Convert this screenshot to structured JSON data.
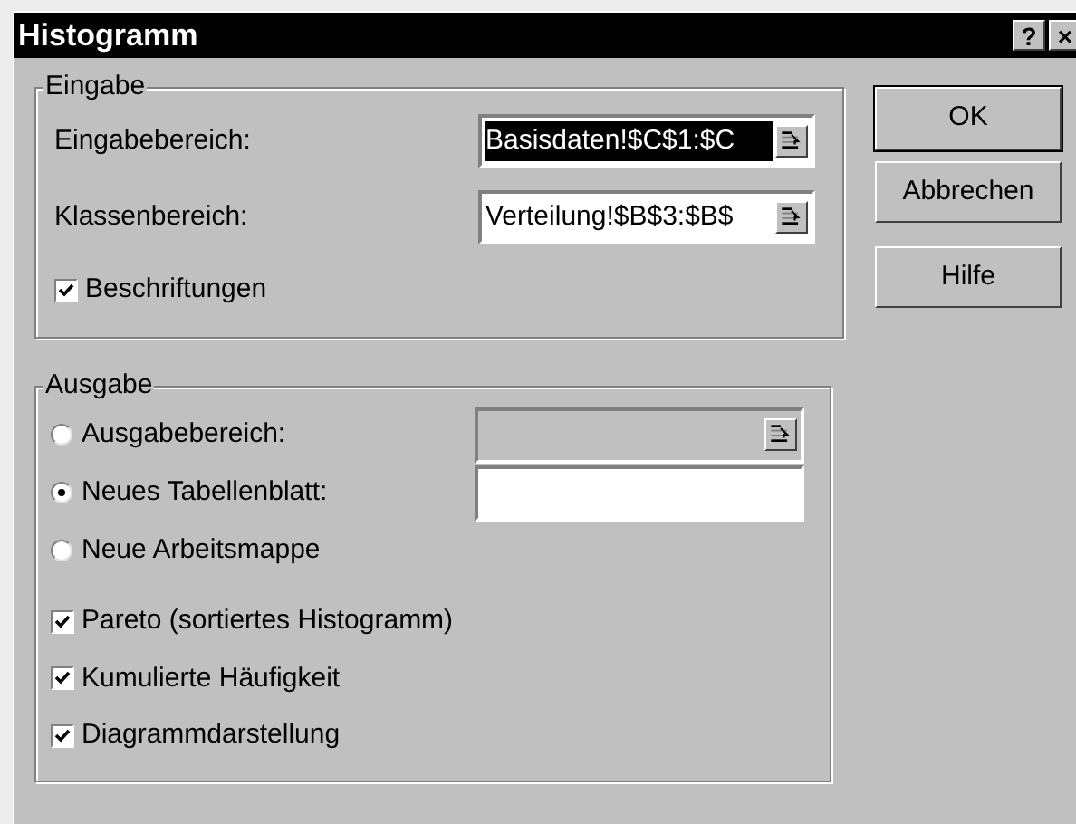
{
  "window": {
    "title": "Histogramm",
    "buttons": [
      "?",
      "×"
    ]
  },
  "input_group": {
    "title": "Eingabe",
    "fields": [
      {
        "label": "Eingabebereich:",
        "value": "Basisdaten!$C$1:$C",
        "highlighted": true
      },
      {
        "label": "Klassenbereich:",
        "value": "Verteilung!$B$3:$B$",
        "highlighted": false
      }
    ],
    "checkbox": {
      "label": "Beschriftungen",
      "checked": true
    }
  },
  "output_group": {
    "title": "Ausgabe",
    "options": [
      {
        "label": "Ausgabebereich:",
        "selected": false,
        "field": {
          "disabled": true,
          "picker": true
        }
      },
      {
        "label": "Neues Tabellenblatt:",
        "selected": true,
        "field": {
          "disabled": false,
          "picker": false
        }
      },
      {
        "label": "Neue Arbeitsmappe",
        "selected": false
      }
    ],
    "checkboxes": [
      {
        "label": "Pareto (sortiertes Histogramm)",
        "checked": true
      },
      {
        "label": "Kumulierte Häufigkeit",
        "checked": true
      },
      {
        "label": "Diagrammdarstellung",
        "checked": true
      }
    ]
  },
  "buttons": [
    {
      "label": "OK",
      "default": true
    },
    {
      "label": "Abbrechen",
      "default": false
    },
    {
      "label": "Hilfe",
      "default": false
    }
  ]
}
